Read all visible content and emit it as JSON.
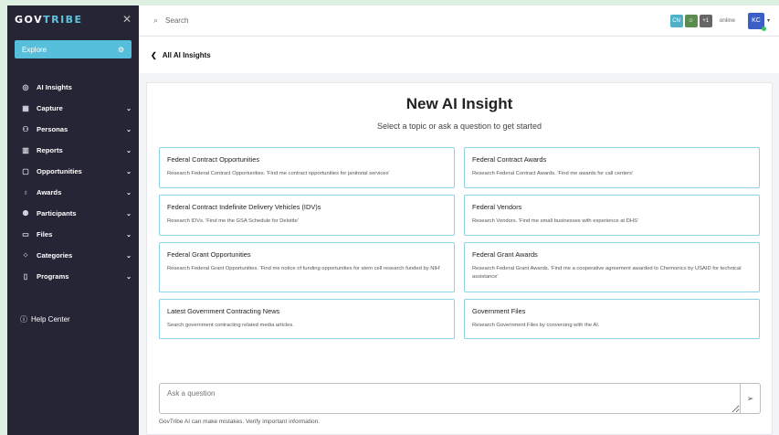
{
  "sidebar": {
    "logo_prefix": "GOV",
    "logo_accent": "TRIBE",
    "close_icon": "close-icon",
    "explore_label": "Explore",
    "explore_icon": "robot-icon",
    "items": [
      {
        "label": "AI Insights",
        "icon": "ai-icon",
        "chevron": false
      },
      {
        "label": "Capture",
        "icon": "grid-icon",
        "chevron": true
      },
      {
        "label": "Personas",
        "icon": "people-icon",
        "chevron": true
      },
      {
        "label": "Reports",
        "icon": "chart-icon",
        "chevron": true
      },
      {
        "label": "Opportunities",
        "icon": "document-icon",
        "chevron": true
      },
      {
        "label": "Awards",
        "icon": "award-icon",
        "chevron": true
      },
      {
        "label": "Participants",
        "icon": "participants-icon",
        "chevron": true
      },
      {
        "label": "Files",
        "icon": "folder-icon",
        "chevron": true
      },
      {
        "label": "Categories",
        "icon": "categories-icon",
        "chevron": true
      },
      {
        "label": "Programs",
        "icon": "programs-icon",
        "chevron": true
      }
    ],
    "help_label": "Help Center"
  },
  "topbar": {
    "search_placeholder": "Search",
    "presence": {
      "cn": "CN",
      "plus": "+1",
      "online": "online"
    },
    "user_initials": "KC"
  },
  "back": {
    "label": "All AI Insights"
  },
  "main": {
    "title": "New AI Insight",
    "subtitle": "Select a topic or ask a question to get started",
    "cards": [
      {
        "title": "Federal Contract Opportunities",
        "desc": "Research Federal Contract Opportunities. 'Find me contract opportunities for janitorial services'"
      },
      {
        "title": "Federal Contract Awards",
        "desc": "Research Federal Contract Awards. 'Find me awards for call centers'"
      },
      {
        "title": "Federal Contract Indefinite Delivery Vehicles (IDV)s",
        "desc": "Research IDVs. 'Find me the GSA Schedule for Deloitte'"
      },
      {
        "title": "Federal Vendors",
        "desc": "Research Vendors. 'Find me small businesses with experience at DHS'"
      },
      {
        "title": "Federal Grant Opportunities",
        "desc": "Research Federal Grant Opportunities. 'Find me notice of funding opportunities for stem cell research funded by NIH'"
      },
      {
        "title": "Federal Grant Awards",
        "desc": "Research Federal Grant Awards. 'Find me a cooperative agreement awarded to Chemonics by USAID for technical assistance'"
      },
      {
        "title": "Latest Government Contracting News",
        "desc": "Search government contracting related media articles."
      },
      {
        "title": "Government Files",
        "desc": "Research Government Files by conversing with the AI."
      }
    ],
    "ask_placeholder": "Ask a question",
    "disclaimer": "GovTribe AI can make mistakes. Verify important information."
  }
}
